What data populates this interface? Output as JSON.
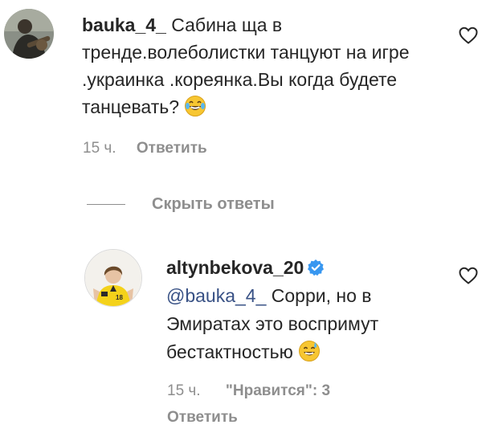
{
  "comments": [
    {
      "username": "bauka_4_",
      "text": "Сабина ща в тренде.волеболистки танцуют на игре .украинка .кореянка.Вы когда будете танцевать?",
      "emoji": "joy-emoji",
      "time": "15 ч.",
      "reply_label": "Ответить"
    },
    {
      "username": "altynbekova_20",
      "verified": true,
      "mention": "@bauka_4_",
      "text": "Сорри, но в Эмиратах это воспримут бестактностью",
      "emoji": "sweat-smile-emoji",
      "time": "15 ч.",
      "likes_label": "\"Нравится\": 3",
      "reply_label": "Ответить"
    }
  ],
  "hide_replies_label": "Скрыть ответы",
  "colors": {
    "text": "#262626",
    "muted": "#8e8e8e",
    "mention": "#385185",
    "verified": "#3897f0"
  }
}
